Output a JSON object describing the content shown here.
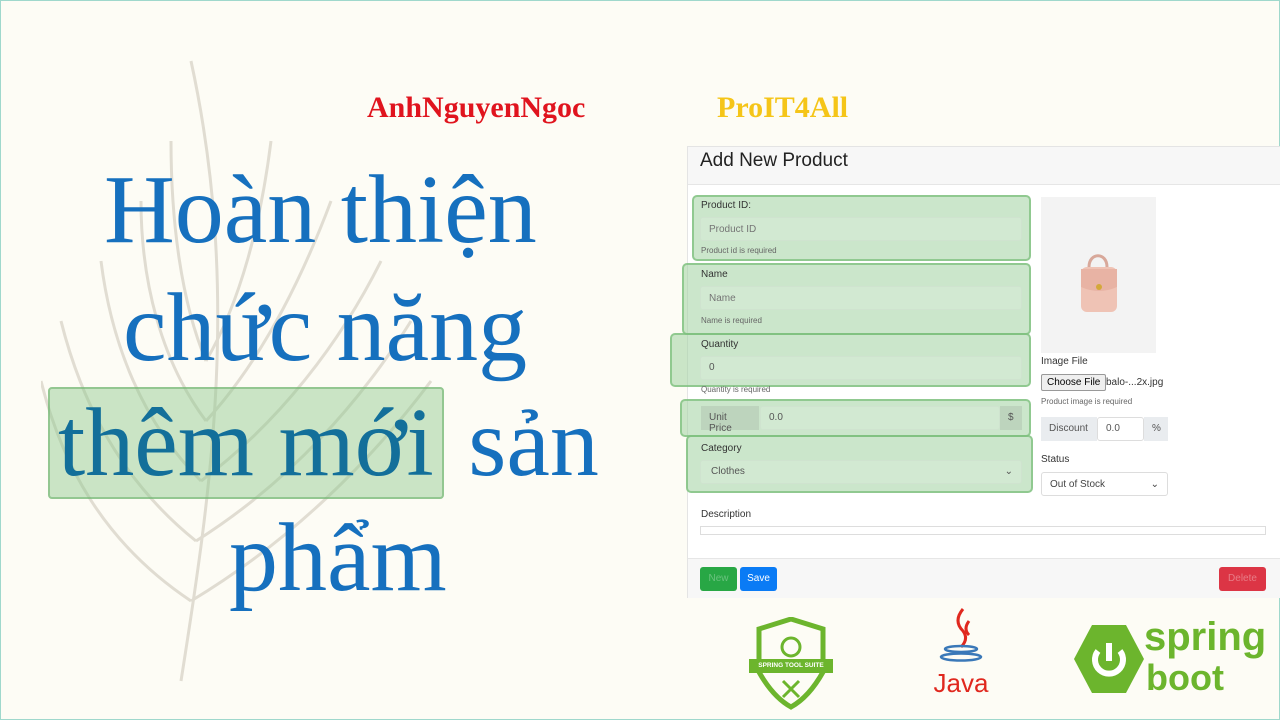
{
  "heading": {
    "line1": "Hoàn thiện",
    "line2": "chức năng",
    "line3_highlight": "thêm mới",
    "line3_rest": "sản",
    "line4": "phẩm"
  },
  "authors": {
    "name1": "AnhNguyenNgoc",
    "name2": "ProIT4All",
    "color1": "#e0141e",
    "color2": "#f5c518"
  },
  "form": {
    "title": "Add New Product",
    "product_id": {
      "label": "Product ID:",
      "placeholder": "Product ID",
      "hint": "Product id is required"
    },
    "name": {
      "label": "Name",
      "placeholder": "Name",
      "hint": "Name is required"
    },
    "quantity": {
      "label": "Quantity",
      "value": "0",
      "hint": "Quantity is required"
    },
    "unit_price": {
      "prefix": "Unit Price",
      "value": "0.0",
      "suffix": "$"
    },
    "category": {
      "label": "Category",
      "selected": "Clothes"
    },
    "image": {
      "label": "Image File",
      "button": "Choose File",
      "filename": "balo-...2x.jpg",
      "hint": "Product image is required"
    },
    "discount": {
      "prefix": "Discount",
      "value": "0.0",
      "suffix": "%"
    },
    "status": {
      "label": "Status",
      "selected": "Out of Stock"
    },
    "description": {
      "label": "Description",
      "value": ""
    },
    "buttons": {
      "new": "New",
      "save": "Save",
      "delete": "Delete"
    }
  },
  "logos": {
    "sts": "SPRING TOOL SUITE",
    "java": "Java",
    "spring": "spring",
    "boot": "boot"
  },
  "colors": {
    "heading": "#1670be",
    "highlight": "#a0d2a0",
    "save": "#0a7bf5",
    "new": "#28a745",
    "delete": "#dc3545",
    "spring": "#6cb52d"
  }
}
